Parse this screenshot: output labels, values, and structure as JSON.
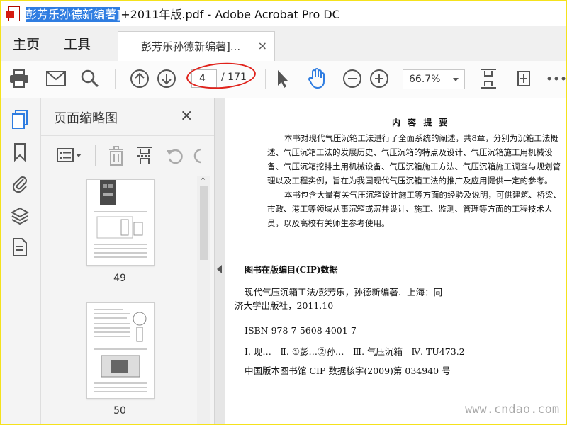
{
  "window": {
    "title_highlighted": "彭芳乐孙德新编著]",
    "title_rest": "+2011年版.pdf - Adobe Acrobat Pro DC"
  },
  "menu": {
    "home": "主页",
    "tools": "工具"
  },
  "tab": {
    "label": "彭芳乐孙德新编著]...",
    "close": "×"
  },
  "toolbar": {
    "page_current": "4",
    "page_total": "/ 171",
    "zoom": "66.7%"
  },
  "panel": {
    "title": "页面缩略图",
    "close": "×",
    "thumbnails": [
      {
        "label": "49"
      },
      {
        "label": "50"
      }
    ]
  },
  "document": {
    "abstract_heading": "内 容 提 要",
    "abstract_p1": "本书对现代气压沉箱工法进行了全面系统的阐述，共8章，分别为沉箱工法概述、气压沉箱工法的发展历史、气压沉箱的特点及设计、气压沉箱施工用机械设备、气压沉箱挖排土用机械设备、气压沉箱施工方法、气压沉箱施工调查与规划管理以及工程实例，旨在为我国现代气压沉箱工法的推广及应用提供一定的参考。",
    "abstract_p2": "本书包含大量有关气压沉箱设计施工等方面的经验及说明，可供建筑、桥梁、市政、港工等领域从事沉箱或沉井设计、施工、监测、管理等方面的工程技术人员，以及高校有关师生参考使用。",
    "cip_title": "图书在版编目(CIP)数据",
    "cip_line1": "现代气压沉箱工法/彭芳乐，孙德新编著.--上海：同",
    "cip_line2": "济大学出版社，2011.10",
    "isbn": "ISBN 978-7-5608-4001-7",
    "classification": "Ⅰ. 现…　Ⅱ. ①彭…②孙…　Ⅲ. 气压沉箱　Ⅳ. TU473.2",
    "cip_number": "中国版本图书馆 CIP 数据核字(2009)第 034940 号"
  },
  "watermark": "www.cndao.com",
  "colors": {
    "accent": "#2f7de1",
    "annotation": "#e0221b",
    "frame": "#f5e21b"
  }
}
